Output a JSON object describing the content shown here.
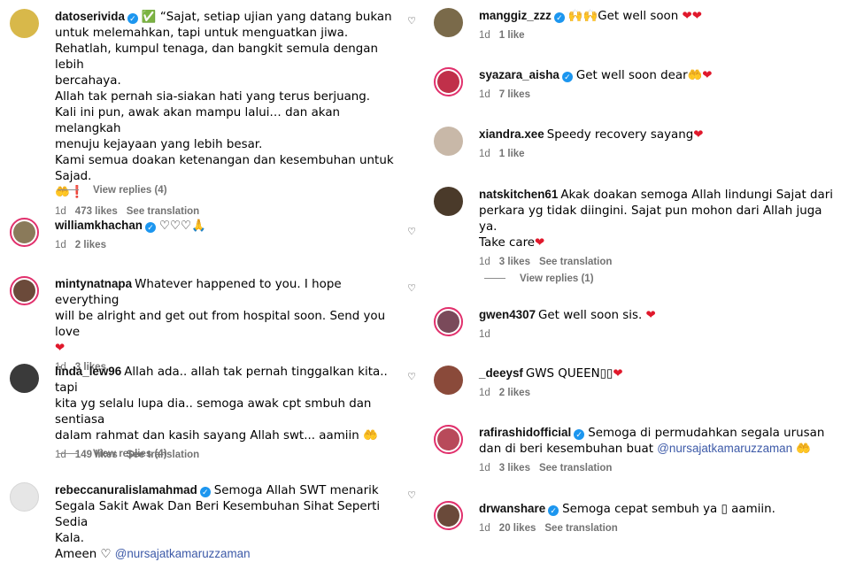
{
  "left": [
    {
      "id": "datoserivida",
      "avatar_color": "#d8b84a",
      "ring": false,
      "username": "datoserivida",
      "verified": true,
      "text": "✅ “Sajat, setiap ujian yang datang bukan\nuntuk melemahkan, tapi untuk menguatkan jiwa.\nRehatlah, kumpul tenaga, dan bangkit semula dengan lebih\nbercahaya.\nAllah tak pernah sia-siakan hati yang terus berjuang.\nKali ini pun, awak akan mampu lalui… dan akan melangkah\nmenuju kejayaan yang lebih besar.\nKami semua doakan ketenangan dan kesembuhan untuk Sajad.\n🤲❗",
      "time": "1d",
      "likes": "473 likes",
      "see_translation": "See translation",
      "view_replies": "View replies (4)"
    },
    {
      "id": "williamkhachan",
      "avatar_color": "#8a7a5a",
      "ring": true,
      "username": "williamkhachan",
      "verified": true,
      "text": "♡♡♡🙏",
      "time": "1d",
      "likes": "2 likes"
    },
    {
      "id": "mintynatnapa",
      "avatar_color": "#6b4a3a",
      "ring": true,
      "username": "mintynatnapa",
      "verified": false,
      "text": "Whatever happened to you. I hope everything\nwill be alright and get out from hospital soon. Send you love\n❤",
      "time": "1d",
      "likes": "3 likes"
    },
    {
      "id": "linda_lew96",
      "avatar_color": "#3a3a3a",
      "ring": false,
      "username": "linda_lew96",
      "verified": false,
      "text": "Allah ada.. allah tak pernah tinggalkan kita.. tapi\nkita yg selalu lupa dia.. semoga awak cpt smbuh dan sentiasa\ndalam rahmat dan kasih sayang Allah swt... aamiin 🤲",
      "time": "1d",
      "likes": "149 likes",
      "see_translation": "See translation",
      "view_replies": "View replies (4)"
    },
    {
      "id": "rebeccanuralislamahmad",
      "avatar_color": "#e6e6e6",
      "ring": false,
      "username": "rebeccanuralislamahmad",
      "verified": true,
      "text": "Semoga Allah SWT menarik\nSegala Sakit Awak Dan Beri Kesembuhan Sihat Seperti Sedia\nKala.\nAmeen ♡ ",
      "mention": "@nursajatkamaruzzaman"
    }
  ],
  "right": [
    {
      "id": "manggiz_zzz",
      "avatar_color": "#7a6a4a",
      "ring": false,
      "username": "manggiz_zzz",
      "verified": true,
      "text": "🙌🙌Get well soon ❤❤",
      "time": "1d",
      "likes": "1 like"
    },
    {
      "id": "syazara_aisha",
      "avatar_color": "#c0304a",
      "ring": true,
      "username": "syazara_aisha",
      "verified": true,
      "text": "Get well soon dear🤲❤",
      "time": "1d",
      "likes": "7 likes"
    },
    {
      "id": "xiandra.xee",
      "avatar_color": "#c8b8a8",
      "ring": false,
      "username": "xiandra.xee",
      "verified": false,
      "text": "Speedy recovery sayang❤",
      "time": "1d",
      "likes": "1 like"
    },
    {
      "id": "natskitchen61",
      "avatar_color": "#4a3a2a",
      "ring": false,
      "username": "natskitchen61",
      "verified": false,
      "text": "Akak doakan semoga Allah lindungi Sajat dari\nperkara yg tidak diingini. Sajat pun mohon dari Allah juga ya.\nTake care❤",
      "time": "1d",
      "likes": "3 likes",
      "see_translation": "See translation",
      "view_replies": "View replies (1)"
    },
    {
      "id": "gwen4307",
      "avatar_color": "#7a4a5a",
      "ring": true,
      "username": "gwen4307",
      "verified": false,
      "text": "Get well soon sis. ❤",
      "time": "1d"
    },
    {
      "id": "_deeysf",
      "avatar_color": "#8a4a3a",
      "ring": false,
      "username": "_deeysf",
      "verified": false,
      "text": "GWS QUEEN▯▯❤",
      "time": "1d",
      "likes": "2 likes"
    },
    {
      "id": "rafirashidofficial",
      "avatar_color": "#b84a5a",
      "ring": true,
      "username": "rafirashidofficial",
      "verified": true,
      "text": "Semoga di permudahkan segala urusan\ndan di beri kesembuhan buat ",
      "mention": "@nursajatkamaruzzaman",
      "text_after": " 🤲",
      "time": "1d",
      "likes": "3 likes",
      "see_translation": "See translation"
    },
    {
      "id": "drwanshare",
      "avatar_color": "#6a4a3a",
      "ring": true,
      "username": "drwanshare",
      "verified": true,
      "text": "Semoga cepat sembuh ya ▯ aamiin.",
      "time": "1d",
      "likes": "20 likes",
      "see_translation": "See translation"
    }
  ],
  "icons": {
    "like": "♡",
    "verified": "✓"
  },
  "colors": {
    "verified": "#1c96ef",
    "ring": "#e1306c",
    "heart": "#e0182b",
    "mention": "#3d5aa8"
  }
}
